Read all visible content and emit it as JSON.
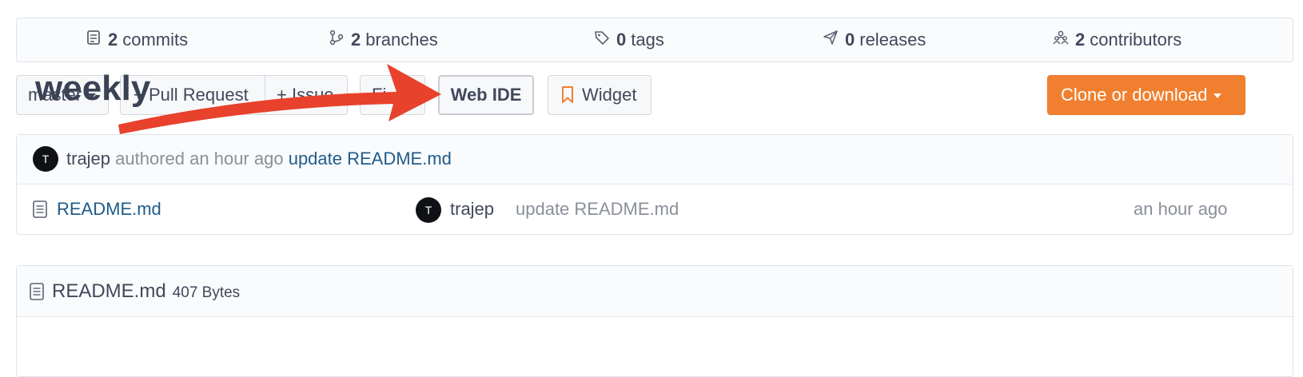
{
  "stats": [
    {
      "icon": "commit-icon",
      "count": "2",
      "label": "commits"
    },
    {
      "icon": "branch-icon",
      "count": "2",
      "label": "branches"
    },
    {
      "icon": "tag-icon",
      "count": "0",
      "label": "tags"
    },
    {
      "icon": "rocket-icon",
      "count": "0",
      "label": "releases"
    },
    {
      "icon": "contributors-icon",
      "count": "2",
      "label": "contributors"
    }
  ],
  "toolbar": {
    "branch": "master",
    "pull_request": "+ Pull Request",
    "merge_partial": "+ Issue",
    "find_partial": "Fi",
    "web_ide": "Web IDE",
    "widget": "Widget",
    "clone": "Clone or download"
  },
  "last_commit": {
    "avatar": "T",
    "author": "trajep",
    "action": "authored an hour ago",
    "message": "update README.md"
  },
  "files": [
    {
      "icon": "file-icon",
      "name": "README.md",
      "avatar": "T",
      "author": "trajep",
      "message": "update README.md",
      "time": "an hour ago"
    }
  ],
  "readme": {
    "title": "README.md",
    "size": "407 Bytes",
    "heading": "weekly"
  },
  "colors": {
    "accent": "#f0802f",
    "link": "#1f5b8a",
    "arrow": "#e8412c"
  }
}
